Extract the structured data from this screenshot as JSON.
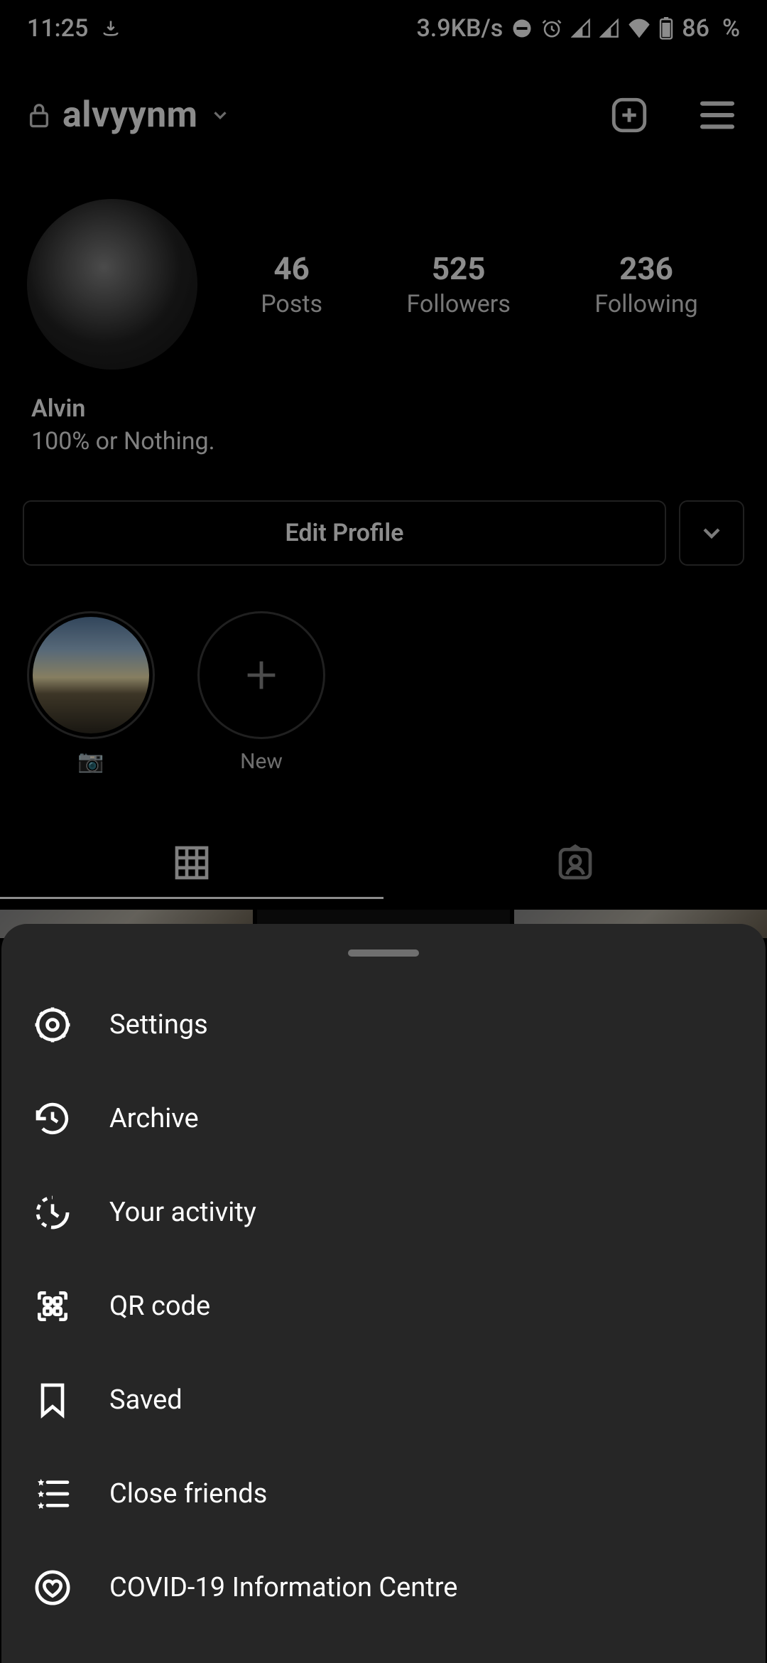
{
  "status": {
    "time": "11:25",
    "net_speed": "3.9KB/s",
    "battery_pct": "86",
    "battery_pct_sym": "%"
  },
  "header": {
    "username": "alvyynm"
  },
  "stats": {
    "posts_value": "46",
    "posts_label": "Posts",
    "followers_value": "525",
    "followers_label": "Followers",
    "following_value": "236",
    "following_label": "Following"
  },
  "bio": {
    "display_name": "Alvin",
    "text": "100% or Nothing."
  },
  "actions": {
    "edit_profile": "Edit Profile"
  },
  "highlights": [
    {
      "label": "📷"
    },
    {
      "label": "New"
    }
  ],
  "menu": [
    {
      "key": "settings",
      "label": "Settings"
    },
    {
      "key": "archive",
      "label": "Archive"
    },
    {
      "key": "activity",
      "label": "Your activity"
    },
    {
      "key": "qr",
      "label": "QR code"
    },
    {
      "key": "saved",
      "label": "Saved"
    },
    {
      "key": "close_friends",
      "label": "Close friends"
    },
    {
      "key": "covid",
      "label": "COVID-19 Information Centre"
    }
  ]
}
